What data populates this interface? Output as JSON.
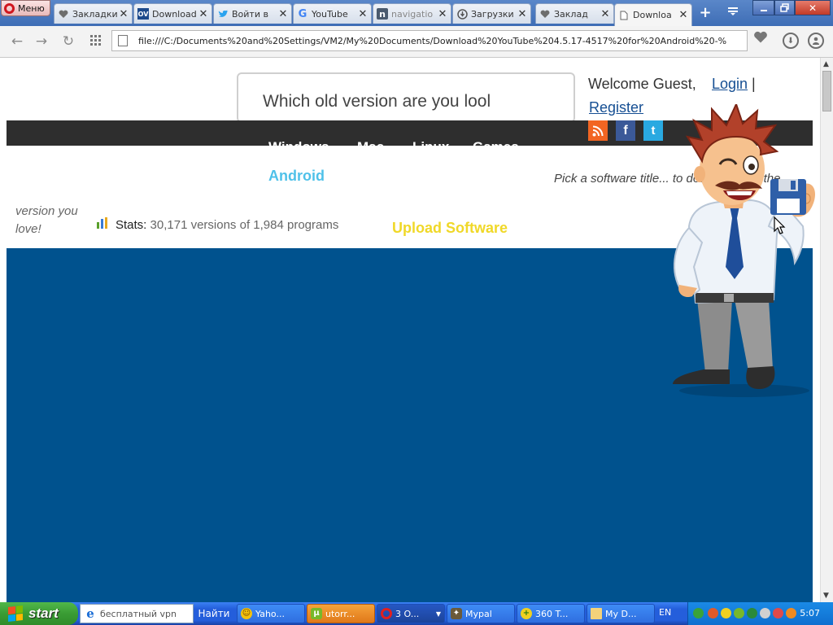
{
  "browser": {
    "menu_label": "Меню",
    "tabs": [
      {
        "label": "Закладки",
        "icon": "heart-icon",
        "active": false
      },
      {
        "label": "Download",
        "icon": "ov-logo-icon",
        "active": false
      },
      {
        "label": "Войти в",
        "icon": "twitter-bird-icon",
        "active": false
      },
      {
        "label": "YouTube",
        "icon": "google-g-icon",
        "active": false
      },
      {
        "label": "navigatio",
        "icon": "n-logo-icon",
        "active": false
      },
      {
        "label": "Загрузки",
        "icon": "download-circle-icon",
        "active": false
      },
      {
        "label": "Заклад",
        "icon": "heart-icon",
        "active": false
      },
      {
        "label": "Downloa",
        "icon": "page-icon",
        "active": true
      }
    ],
    "address": "file:///C:/Documents%20and%20Settings/VM2/My%20Documents/Download%20YouTube%204.5.17-4517%20for%20Android%20-%"
  },
  "page": {
    "search_placeholder": "Which old version are you lool",
    "welcome": "Welcome Guest,",
    "login": "Login",
    "separator": "|",
    "register": "Register",
    "nav_items": [
      "Windows",
      "Mac",
      "Linux",
      "Games"
    ],
    "android_link": "Android",
    "pick_text": "Pick a software title... to downgrade to the",
    "lang_label": "En",
    "tagline": "version you love!",
    "stats_label": "Stats:",
    "stats_text": "30,171 versions of 1,984 programs",
    "upload_link": "Upload Software",
    "social": [
      {
        "icon": "rss-icon",
        "color": "#f26522"
      },
      {
        "icon": "facebook-icon",
        "color": "#3b5998"
      },
      {
        "icon": "twitter-icon",
        "color": "#29a9e1"
      }
    ],
    "banner_color": "#00528e"
  },
  "taskbar": {
    "start_label": "start",
    "search_placeholder": "бесплатный vpn",
    "find_label": "Найти",
    "tasks": [
      {
        "label": "Yaho...",
        "icon": "yahoo-smiley-icon",
        "style": "blue"
      },
      {
        "label": "utorr...",
        "icon": "utorrent-icon",
        "style": "orange"
      },
      {
        "label": "3 O...",
        "icon": "opera-icon",
        "style": "dark"
      },
      {
        "label": "Mypal",
        "icon": "mypal-icon",
        "style": "blue"
      },
      {
        "label": "360 T...",
        "icon": "360-total-security-icon",
        "style": "blue"
      },
      {
        "label": "My D...",
        "icon": "folder-icon",
        "style": "blue"
      }
    ],
    "language": "EN",
    "clock": "5:07"
  }
}
